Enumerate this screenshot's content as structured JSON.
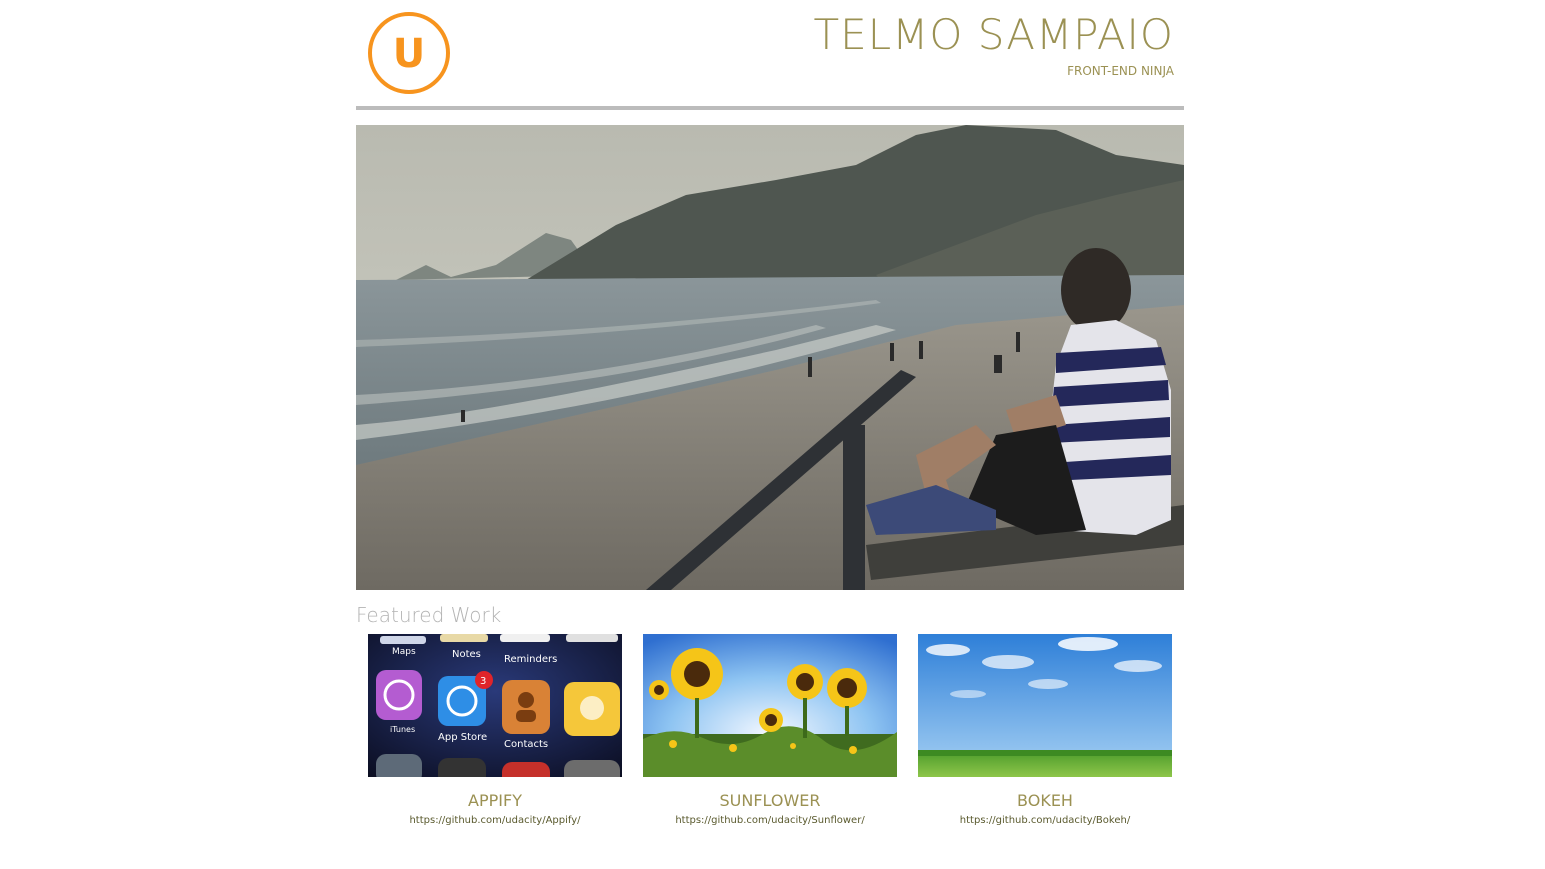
{
  "header": {
    "logo_letter": "U",
    "title": "TELMO SAMPAIO",
    "subtitle": "FRONT-END NINJA"
  },
  "featured": {
    "heading": "Featured Work",
    "items": [
      {
        "title": "APPIFY",
        "url": "https://github.com/udacity/Appify/"
      },
      {
        "title": "SUNFLOWER",
        "url": "https://github.com/udacity/Sunflower/"
      },
      {
        "title": "BOKEH",
        "url": "https://github.com/udacity/Bokeh/"
      }
    ]
  },
  "appify_icons": {
    "maps": "Maps",
    "notes": "Notes",
    "reminders": "Reminders",
    "itunes": "iTunes",
    "app_store": "App Store",
    "contacts": "Contacts",
    "badge": "3"
  },
  "colors": {
    "accent": "#f7941e",
    "title_text": "#9b9153",
    "divider": "#bcbcbc",
    "heading_muted": "#b3b3b3"
  }
}
